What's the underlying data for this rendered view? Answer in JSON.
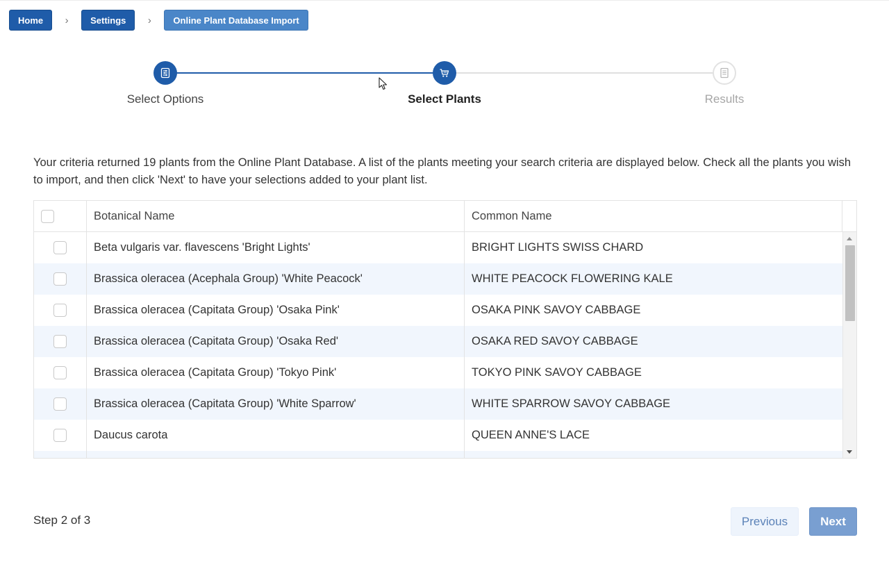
{
  "breadcrumb": {
    "items": [
      {
        "label": "Home"
      },
      {
        "label": "Settings"
      },
      {
        "label": "Online Plant Database Import"
      }
    ],
    "separator": "›"
  },
  "stepper": {
    "steps": [
      {
        "label": "Select Options",
        "icon": "list-settings-icon",
        "state": "done"
      },
      {
        "label": "Select Plants",
        "icon": "cart-icon",
        "state": "current"
      },
      {
        "label": "Results",
        "icon": "document-icon",
        "state": "upcoming"
      }
    ]
  },
  "intro": {
    "text": "Your criteria returned 19 plants from the Online Plant Database. A list of the plants meeting your search criteria are displayed below. Check all the plants you wish to import, and then click 'Next' to have your selections added to your plant list."
  },
  "table": {
    "headers": {
      "botanical": "Botanical Name",
      "common": "Common Name"
    },
    "rows": [
      {
        "botanical": "Beta vulgaris var. flavescens 'Bright Lights'",
        "common": "BRIGHT LIGHTS SWISS CHARD"
      },
      {
        "botanical": "Brassica oleracea (Acephala Group) 'White Peacock'",
        "common": "WHITE PEACOCK FLOWERING KALE"
      },
      {
        "botanical": "Brassica oleracea (Capitata Group) 'Osaka Pink'",
        "common": "OSAKA PINK SAVOY CABBAGE"
      },
      {
        "botanical": "Brassica oleracea (Capitata Group) 'Osaka Red'",
        "common": "OSAKA RED SAVOY CABBAGE"
      },
      {
        "botanical": "Brassica oleracea (Capitata Group) 'Tokyo Pink'",
        "common": "TOKYO PINK SAVOY CABBAGE"
      },
      {
        "botanical": "Brassica oleracea (Capitata Group) 'White Sparrow'",
        "common": "WHITE SPARROW SAVOY CABBAGE"
      },
      {
        "botanical": "Daucus carota",
        "common": "QUEEN ANNE'S LACE"
      }
    ]
  },
  "footer": {
    "step_count": "Step 2 of 3",
    "previous_label": "Previous",
    "next_label": "Next"
  },
  "colors": {
    "primary": "#1f5ca9",
    "breadcrumb_current": "#4a86c8",
    "row_alt": "#f1f6fd",
    "next_button": "#799fd1"
  }
}
